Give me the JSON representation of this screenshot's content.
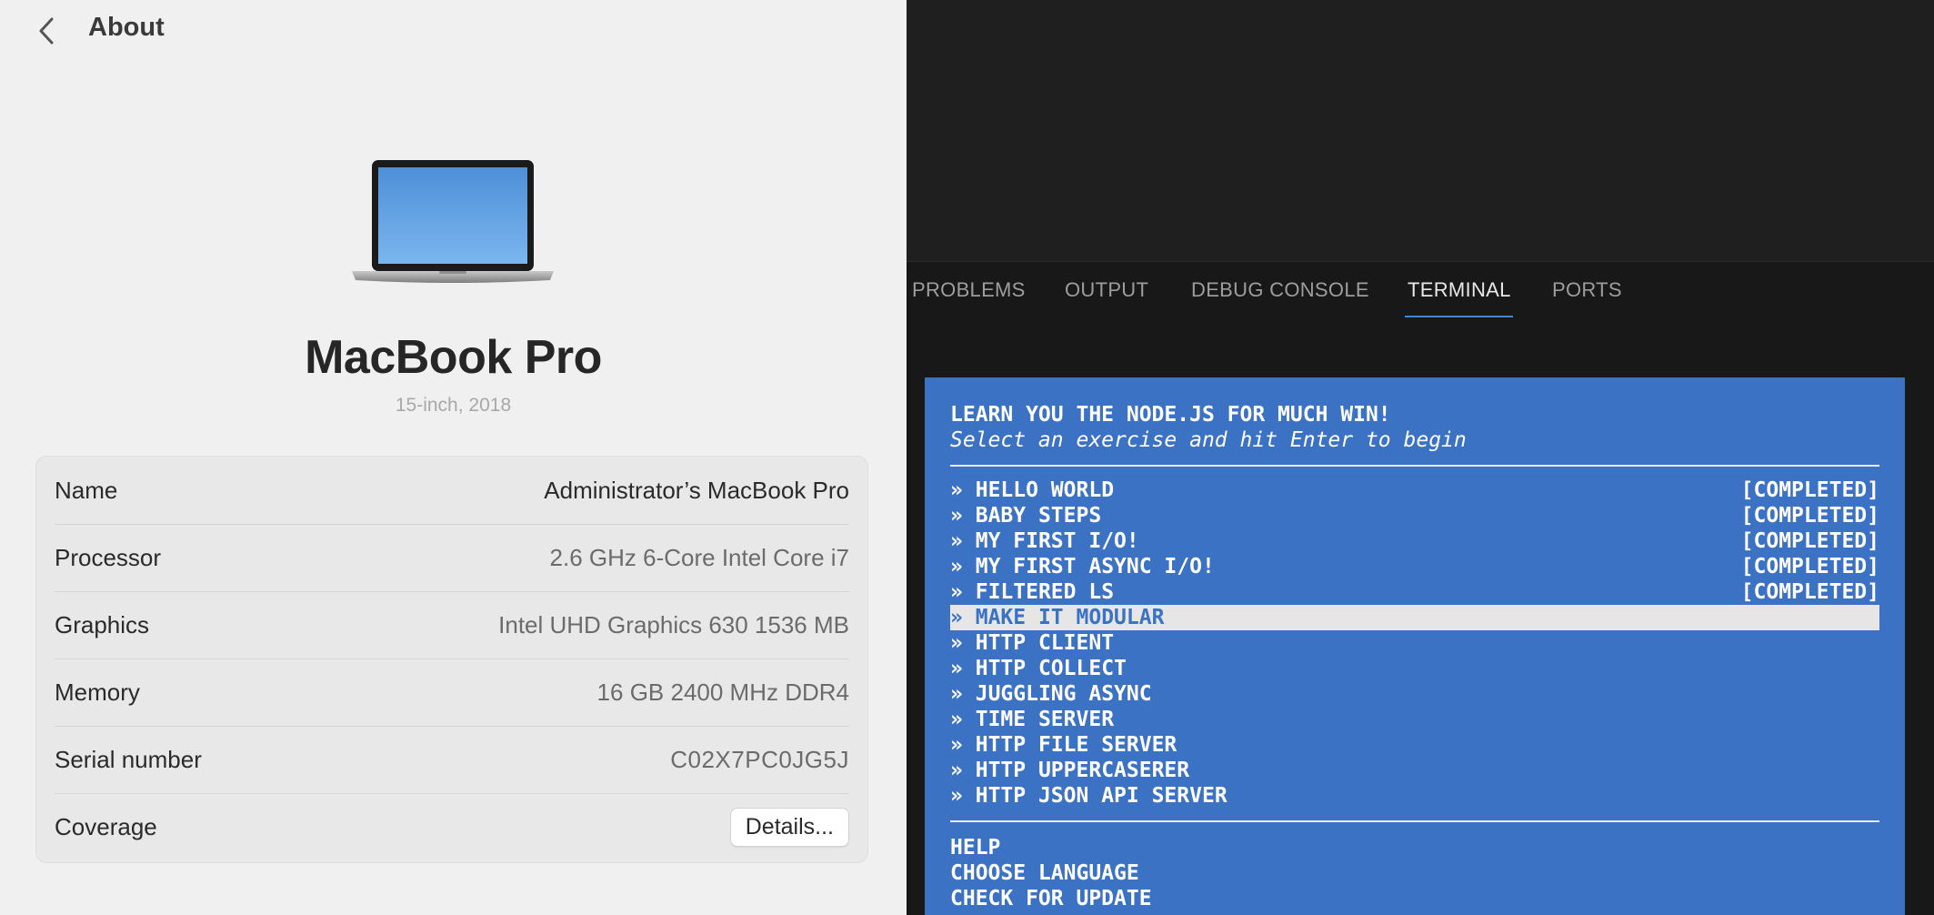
{
  "about": {
    "title": "About",
    "model_name": "MacBook Pro",
    "model_subtitle": "15-inch, 2018",
    "specs": [
      {
        "label": "Name",
        "value": "Administrator’s MacBook Pro"
      },
      {
        "label": "Processor",
        "value": "2.6 GHz 6-Core Intel Core i7"
      },
      {
        "label": "Graphics",
        "value": "Intel UHD Graphics 630 1536 MB"
      },
      {
        "label": "Memory",
        "value": "16 GB 2400 MHz DDR4"
      },
      {
        "label": "Serial number",
        "value": "C02X7PC0JG5J"
      }
    ],
    "coverage": {
      "label": "Coverage",
      "button": "Details..."
    }
  },
  "panel": {
    "tabs": [
      {
        "label": "PROBLEMS"
      },
      {
        "label": "OUTPUT"
      },
      {
        "label": "DEBUG CONSOLE"
      },
      {
        "label": "TERMINAL"
      },
      {
        "label": "PORTS"
      }
    ],
    "active_tab": "TERMINAL"
  },
  "terminal": {
    "heading": "LEARN YOU THE NODE.JS FOR MUCH WIN!",
    "subheading": "Select an exercise and hit Enter to begin",
    "bullet": "»",
    "exercises": [
      {
        "name": "HELLO WORLD",
        "status": "[COMPLETED]"
      },
      {
        "name": "BABY STEPS",
        "status": "[COMPLETED]"
      },
      {
        "name": "MY FIRST I/O!",
        "status": "[COMPLETED]"
      },
      {
        "name": "MY FIRST ASYNC I/O!",
        "status": "[COMPLETED]"
      },
      {
        "name": "FILTERED LS",
        "status": "[COMPLETED]"
      },
      {
        "name": "MAKE IT MODULAR",
        "status": ""
      },
      {
        "name": "HTTP CLIENT",
        "status": ""
      },
      {
        "name": "HTTP COLLECT",
        "status": ""
      },
      {
        "name": "JUGGLING ASYNC",
        "status": ""
      },
      {
        "name": "TIME SERVER",
        "status": ""
      },
      {
        "name": "HTTP FILE SERVER",
        "status": ""
      },
      {
        "name": "HTTP UPPERCASERER",
        "status": ""
      },
      {
        "name": "HTTP JSON API SERVER",
        "status": ""
      }
    ],
    "selected_exercise": "MAKE IT MODULAR",
    "menu": [
      {
        "label": "HELP"
      },
      {
        "label": "CHOOSE LANGUAGE"
      },
      {
        "label": "CHECK FOR UPDATE"
      }
    ],
    "colors": {
      "background": "#3b72c3",
      "text": "#ffffff",
      "highlight": "#e6e6e6"
    }
  }
}
